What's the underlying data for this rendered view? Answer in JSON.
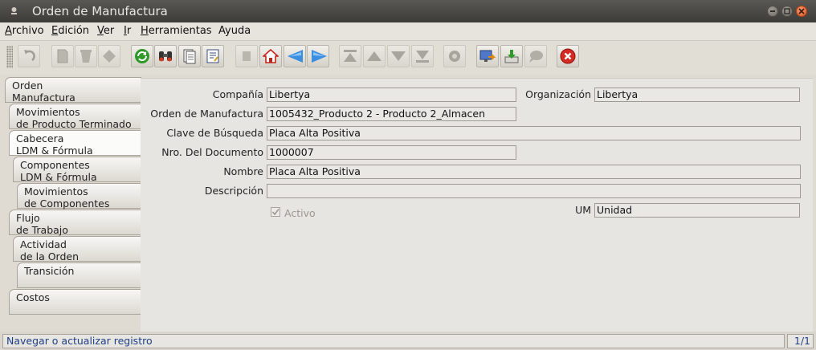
{
  "window": {
    "title": "Orden de Manufactura"
  },
  "menu": [
    {
      "key": "A",
      "rest": "rchivo"
    },
    {
      "key": "E",
      "rest": "dición"
    },
    {
      "key": "V",
      "rest": "er"
    },
    {
      "key": "I",
      "rest": "r"
    },
    {
      "key": "H",
      "rest": "erramientas"
    },
    {
      "key": "",
      "rest": "Ayuda"
    }
  ],
  "toolbar": {
    "icons": [
      "undo-icon",
      "new-record-icon",
      "delete-icon",
      "delete-selection-icon",
      "refresh-icon",
      "find-icon",
      "history-icon",
      "report-icon",
      "attachment-icon",
      "home-icon",
      "previous-tab-icon",
      "next-tab-icon",
      "first-record-icon",
      "previous-record-icon",
      "next-record-icon",
      "last-record-icon",
      "process-icon",
      "zoom-across-icon",
      "export-icon",
      "chat-icon",
      "exit-icon"
    ]
  },
  "tabs": [
    {
      "line1": "Orden",
      "line2": "Manufactura"
    },
    {
      "line1": "Movimientos",
      "line2": "de Producto Terminado"
    },
    {
      "line1": "Cabecera",
      "line2": "LDM & Fórmula"
    },
    {
      "line1": "Componentes",
      "line2": "LDM & Fórmula"
    },
    {
      "line1": "Movimientos",
      "line2": "de Componentes"
    },
    {
      "line1": "Flujo",
      "line2": "de Trabajo"
    },
    {
      "line1": "Actividad",
      "line2": "de la Orden"
    },
    {
      "line1": "Transición",
      "line2": ""
    },
    {
      "line1": "Costos",
      "line2": ""
    }
  ],
  "form": {
    "company_label": "Compañía",
    "company_value": "Libertya",
    "org_label": "Organización",
    "org_value": "Libertya",
    "mo_label": "Orden de Manufactura",
    "mo_value": "1005432_Producto 2 - Producto 2_Almacen",
    "search_key_label": "Clave de Búsqueda",
    "search_key_value": "Placa Alta Positiva",
    "doc_no_label": "Nro. Del Documento",
    "doc_no_value": "1000007",
    "name_label": "Nombre",
    "name_value": "Placa Alta Positiva",
    "description_label": "Descripción",
    "description_value": "",
    "active_label": "Activo",
    "active_checked": true,
    "uom_label": "UM",
    "uom_value": "Unidad"
  },
  "status": {
    "message": "Navegar o actualizar registro",
    "record": "1/1"
  }
}
